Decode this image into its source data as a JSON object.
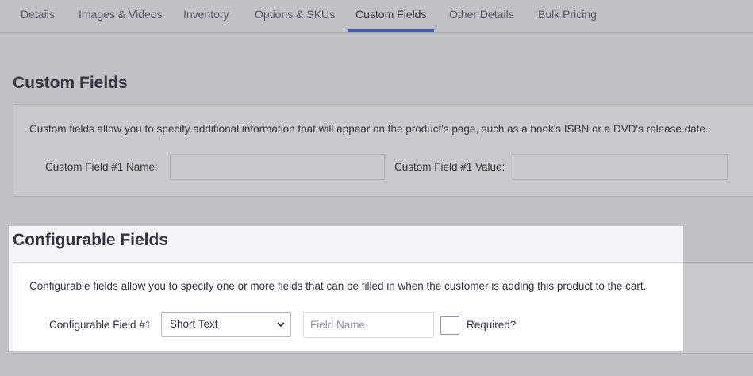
{
  "tabs": [
    {
      "label": "Details"
    },
    {
      "label": "Images & Videos"
    },
    {
      "label": "Inventory"
    },
    {
      "label": "Options & SKUs"
    },
    {
      "label": "Custom Fields",
      "active": true
    },
    {
      "label": "Other Details"
    },
    {
      "label": "Bulk Pricing"
    }
  ],
  "custom_fields": {
    "title": "Custom Fields",
    "description": "Custom fields allow you to specify additional information that will appear on the product's page, such as a book's ISBN or a DVD's release date.",
    "name_label": "Custom Field #1 Name:",
    "name_value": "",
    "value_label": "Custom Field #1 Value:",
    "value_value": ""
  },
  "configurable_fields": {
    "title": "Configurable Fields",
    "description": "Configurable fields allow you to specify one or more fields that can be filled in when the customer is adding this product to the cart.",
    "field_label": "Configurable Field #1",
    "type_selected": "Short Text",
    "field_name_placeholder": "Field Name",
    "required_label": "Required?",
    "required_checked": false
  },
  "colors": {
    "accent": "#3c64f4",
    "background": "#f4f5f9",
    "panel": "#ffffff",
    "border": "#d9dce9"
  }
}
